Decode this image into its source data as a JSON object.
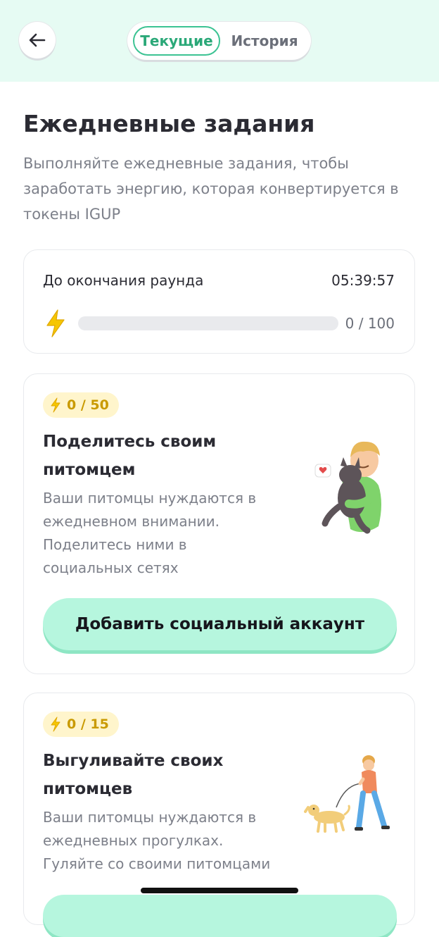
{
  "header": {
    "back_icon": "arrow-left-icon",
    "tabs": [
      {
        "label": "Текущие",
        "active": true
      },
      {
        "label": "История",
        "active": false
      }
    ],
    "accent_color": "#3cc393",
    "background_color": "#e6fbf3"
  },
  "page": {
    "title": "Ежедневные задания",
    "subtitle": "Выполняйте ежедневные задания, чтобы заработать энергию, которая конвертируется в токены IGUP"
  },
  "round": {
    "label": "До окончания раунда",
    "time_left": "05:39:57",
    "icon": "lightning-icon",
    "progress_text": "0 / 100",
    "progress_fraction": 0
  },
  "tasks": [
    {
      "badge": "0 / 50",
      "title": "Поделитесь своим питомцем",
      "description": "Ваши питомцы нуждаются в ежедневном внимании. Поделитесь ними в социальных сетях",
      "button_label": "Добавить социальный аккаунт",
      "illustration": "person-hugging-cat-illustration"
    },
    {
      "badge": "0 / 15",
      "title": "Выгуливайте своих питомцев",
      "description": "Ваши питомцы нуждаются в ежедневных прогулках. Гуляйте со своими питомцами",
      "button_label": "",
      "illustration": "person-walking-dog-illustration"
    }
  ]
}
